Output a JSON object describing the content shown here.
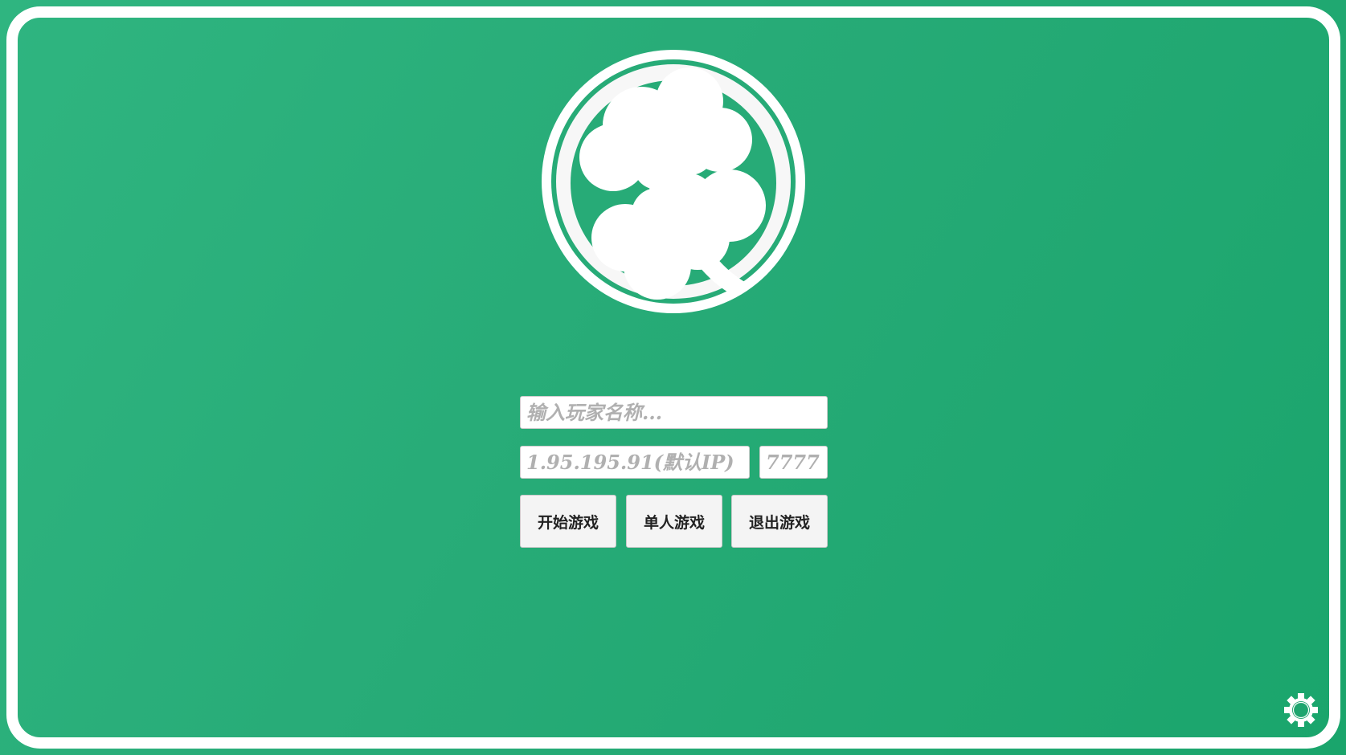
{
  "colors": {
    "background": "#27ab77",
    "frame": "#ffffff",
    "button": "#f4f4f4"
  },
  "logo": {
    "icon": "four-leaf-clover-icon"
  },
  "form": {
    "player_name_placeholder": "输入玩家名称...",
    "ip_placeholder": "1.95.195.91(默认IP)",
    "port_placeholder": "7777"
  },
  "buttons": {
    "start": "开始游戏",
    "single": "单人游戏",
    "quit": "退出游戏"
  },
  "settings": {
    "icon": "gear-icon"
  }
}
